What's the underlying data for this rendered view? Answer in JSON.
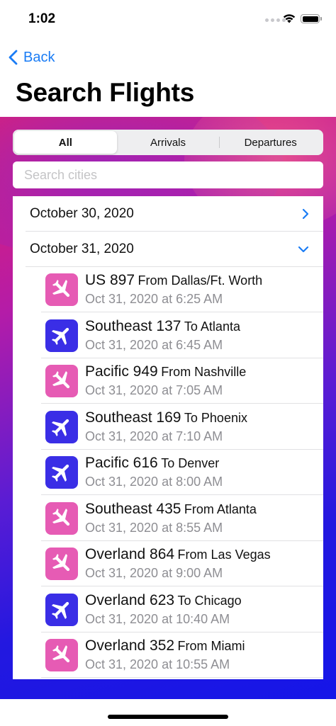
{
  "status": {
    "time": "1:02"
  },
  "nav": {
    "back_label": "Back",
    "title": "Search Flights"
  },
  "segments": [
    {
      "label": "All",
      "active": true
    },
    {
      "label": "Arrivals",
      "active": false
    },
    {
      "label": "Departures",
      "active": false
    }
  ],
  "search": {
    "placeholder": "Search cities",
    "value": ""
  },
  "dates": [
    {
      "label": "October 30, 2020",
      "state": "collapsed"
    },
    {
      "label": "October 31, 2020",
      "state": "expanded"
    }
  ],
  "flights": [
    {
      "number": "US 897",
      "route": "From Dallas/Ft. Worth",
      "time": "Oct 31, 2020 at 6:25 AM",
      "kind": "arrival"
    },
    {
      "number": "Southeast 137",
      "route": "To Atlanta",
      "time": "Oct 31, 2020 at 6:45 AM",
      "kind": "departure"
    },
    {
      "number": "Pacific 949",
      "route": "From Nashville",
      "time": "Oct 31, 2020 at 7:05 AM",
      "kind": "arrival"
    },
    {
      "number": "Southeast 169",
      "route": "To Phoenix",
      "time": "Oct 31, 2020 at 7:10 AM",
      "kind": "departure"
    },
    {
      "number": "Pacific 616",
      "route": "To Denver",
      "time": "Oct 31, 2020 at 8:00 AM",
      "kind": "departure"
    },
    {
      "number": "Southeast 435",
      "route": "From Atlanta",
      "time": "Oct 31, 2020 at 8:55 AM",
      "kind": "arrival"
    },
    {
      "number": "Overland 864",
      "route": "From Las Vegas",
      "time": "Oct 31, 2020 at 9:00 AM",
      "kind": "arrival"
    },
    {
      "number": "Overland 623",
      "route": "To Chicago",
      "time": "Oct 31, 2020 at 10:40 AM",
      "kind": "departure"
    },
    {
      "number": "Overland 352",
      "route": "From Miami",
      "time": "Oct 31, 2020 at 10:55 AM",
      "kind": "arrival"
    }
  ],
  "colors": {
    "accent": "#1a7cf5",
    "arrival": "#e65bb4",
    "departure": "#3a2ee6"
  },
  "icons": {
    "arrival": "airplane-arrival-icon",
    "departure": "airplane-departure-icon"
  }
}
